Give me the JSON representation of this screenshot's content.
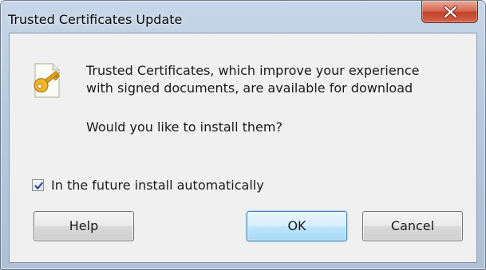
{
  "window": {
    "title": "Trusted Certificates Update"
  },
  "icons": {
    "close": "close-icon",
    "certificate": "certificate-key-icon",
    "check": "checkmark-icon"
  },
  "message": {
    "line1": "Trusted Certificates, which improve your experience",
    "line2": "with signed documents, are available for download",
    "question": "Would you like to install them?"
  },
  "options": {
    "auto_install_label": "In the future install automatically",
    "auto_install_checked": true
  },
  "buttons": {
    "help": "Help",
    "ok": "OK",
    "cancel": "Cancel"
  },
  "colors": {
    "close_button": "#c1412a",
    "default_button_border": "#3c7fb1",
    "key_gold": "#e0a21a"
  }
}
